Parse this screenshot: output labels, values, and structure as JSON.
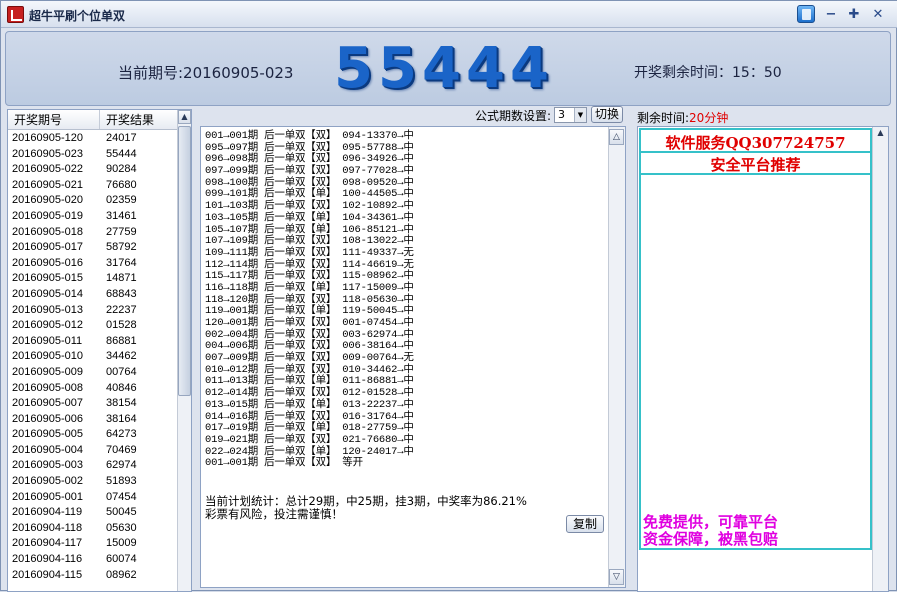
{
  "window": {
    "title": "超牛平刷个位单双"
  },
  "header": {
    "current_period_label": "当前期号:20160905-023",
    "digits": [
      "5",
      "5",
      "4",
      "4",
      "4"
    ],
    "countdown_label": "开奖剩余时间：15：50"
  },
  "history": {
    "columns": [
      "开奖期号",
      "开奖结果"
    ],
    "rows": [
      [
        "20160905-120",
        "24017"
      ],
      [
        "20160905-023",
        "55444"
      ],
      [
        "20160905-022",
        "90284"
      ],
      [
        "20160905-021",
        "76680"
      ],
      [
        "20160905-020",
        "02359"
      ],
      [
        "20160905-019",
        "31461"
      ],
      [
        "20160905-018",
        "27759"
      ],
      [
        "20160905-017",
        "58792"
      ],
      [
        "20160905-016",
        "31764"
      ],
      [
        "20160905-015",
        "14871"
      ],
      [
        "20160905-014",
        "68843"
      ],
      [
        "20160905-013",
        "22237"
      ],
      [
        "20160905-012",
        "01528"
      ],
      [
        "20160905-011",
        "86881"
      ],
      [
        "20160905-010",
        "34462"
      ],
      [
        "20160905-009",
        "00764"
      ],
      [
        "20160905-008",
        "40846"
      ],
      [
        "20160905-007",
        "38154"
      ],
      [
        "20160905-006",
        "38164"
      ],
      [
        "20160905-005",
        "64273"
      ],
      [
        "20160905-004",
        "70469"
      ],
      [
        "20160905-003",
        "62974"
      ],
      [
        "20160905-002",
        "51893"
      ],
      [
        "20160905-001",
        "07454"
      ],
      [
        "20160904-119",
        "50045"
      ],
      [
        "20160904-118",
        "05630"
      ],
      [
        "20160904-117",
        "15009"
      ],
      [
        "20160904-116",
        "60074"
      ],
      [
        "20160904-115",
        "08962"
      ]
    ]
  },
  "settings": {
    "label": "公式期数设置:",
    "value": "3",
    "switch_label": "切换"
  },
  "plan": {
    "lines": [
      "001→001期 后一单双【双】 094-13370→中",
      "095→097期 后一单双【双】 095-57788→中",
      "096→098期 后一单双【双】 096-34926→中",
      "097→099期 后一单双【双】 097-77028→中",
      "098→100期 后一单双【双】 098-09520→中",
      "099→101期 后一单双【单】 100-44505→中",
      "101→103期 后一单双【双】 102-10892→中",
      "103→105期 后一单双【单】 104-34361→中",
      "105→107期 后一单双【单】 106-85121→中",
      "107→109期 后一单双【双】 108-13022→中",
      "109→111期 后一单双【双】 111-49337→无",
      "112→114期 后一单双【双】 114-46619→无",
      "115→117期 后一单双【双】 115-08962→中",
      "116→118期 后一单双【单】 117-15009→中",
      "118→120期 后一单双【双】 118-05630→中",
      "119→001期 后一单双【单】 119-50045→中",
      "120→001期 后一单双【双】 001-07454→中",
      "002→004期 后一单双【双】 003-62974→中",
      "004→006期 后一单双【双】 006-38164→中",
      "007→009期 后一单双【双】 009-00764→无",
      "010→012期 后一单双【双】 010-34462→中",
      "011→013期 后一单双【单】 011-86881→中",
      "012→014期 后一单双【双】 012-01528→中",
      "013→015期 后一单双【单】 013-22237→中",
      "014→016期 后一单双【双】 016-31764→中",
      "017→019期 后一单双【单】 018-27759→中",
      "019→021期 后一单双【双】 021-76680→中",
      "022→024期 后一单双【单】 120-24017→中",
      "001→001期 后一单双【双】 等开"
    ],
    "stats_line1": "当前计划统计：总计29期，中25期，挂3期，中奖率为86.21%",
    "stats_line2": "彩票有风险，投注需谨慎！",
    "copy_label": "复制"
  },
  "right": {
    "remain_label": "剩余时间:",
    "remain_value": "20分钟",
    "ad_line1": "软件服务QQ307724757",
    "ad_line2": "安全平台推荐",
    "promo_line1": "免费提供，可靠平台",
    "promo_line2": "资金保障，被黑包赔"
  },
  "colors": {
    "accent_red": "#e00000",
    "digit_blue": "#1a64c8",
    "ad_border": "#35c1c9",
    "promo_magenta": "#e000e0"
  }
}
